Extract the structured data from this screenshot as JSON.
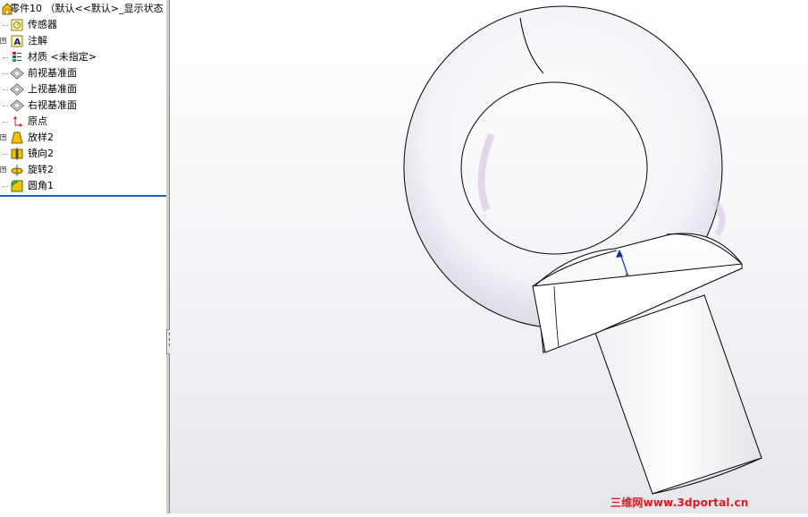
{
  "tree": {
    "root": "零件10 （默认<<默认>_显示状态",
    "items": [
      {
        "label": "传感器",
        "icon": "sensor-icon",
        "expandable": false
      },
      {
        "label": "注解",
        "icon": "annotation-icon",
        "expandable": true
      },
      {
        "label": "材质 <未指定>",
        "icon": "material-icon",
        "expandable": false
      },
      {
        "label": "前视基准面",
        "icon": "plane-icon",
        "expandable": false
      },
      {
        "label": "上视基准面",
        "icon": "plane-icon",
        "expandable": false
      },
      {
        "label": "右视基准面",
        "icon": "plane-icon",
        "expandable": false
      },
      {
        "label": "原点",
        "icon": "origin-icon",
        "expandable": false
      },
      {
        "label": "放样2",
        "icon": "loft-icon",
        "expandable": true
      },
      {
        "label": "镜向2",
        "icon": "mirror-icon",
        "expandable": false
      },
      {
        "label": "旋转2",
        "icon": "revolve-icon",
        "expandable": true
      },
      {
        "label": "圆角1",
        "icon": "fillet-icon",
        "expandable": false
      }
    ]
  },
  "watermark": "三维网www.3dportal.cn",
  "colors": {
    "rollback_bar": "#1f5fb4",
    "watermark": "#e8141d",
    "model_fill": "#ffffff",
    "model_shade": "#c8c8d2"
  }
}
